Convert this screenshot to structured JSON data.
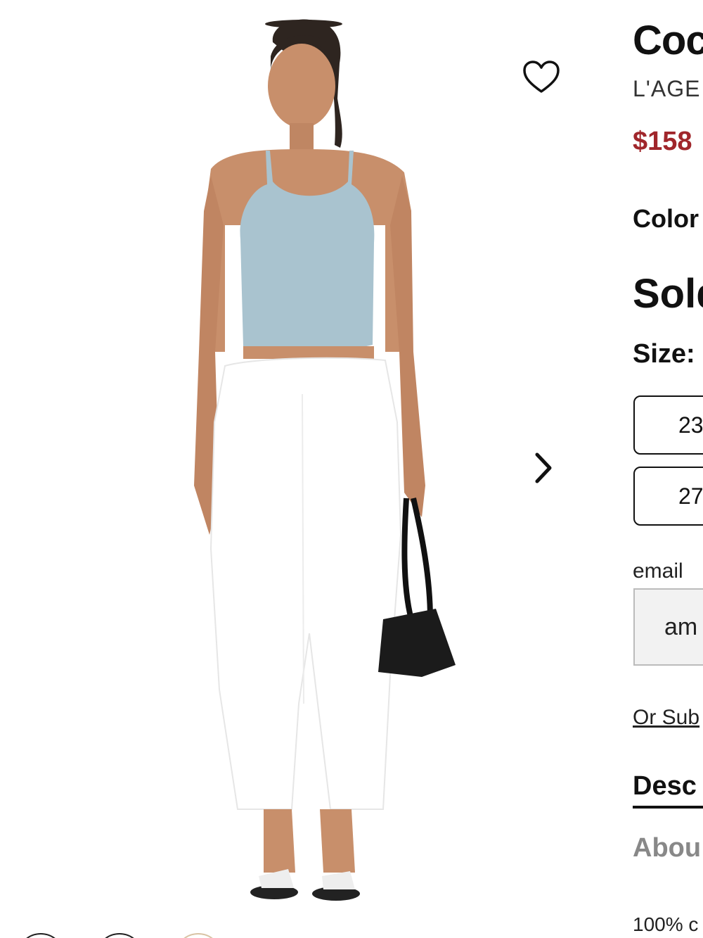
{
  "product": {
    "title": "Coc",
    "brand": "L'AGE",
    "price": "$158",
    "color_label": "Color",
    "status": "Sold",
    "size_label": "Size:",
    "sizes": [
      "23",
      "27"
    ],
    "email_label": "email",
    "email_value": "am",
    "subscribe_link": "Or Sub",
    "tabs": [
      "Desc",
      "Abou"
    ],
    "composition": "100% c"
  },
  "colors": {
    "accent_price": "#a0262b",
    "text": "#111111",
    "muted_tab": "#888888",
    "top": "#a9c3cf",
    "pants": "#ffffff"
  },
  "icons": {
    "favorite": "heart-outline-icon",
    "next": "chevron-right-icon"
  }
}
